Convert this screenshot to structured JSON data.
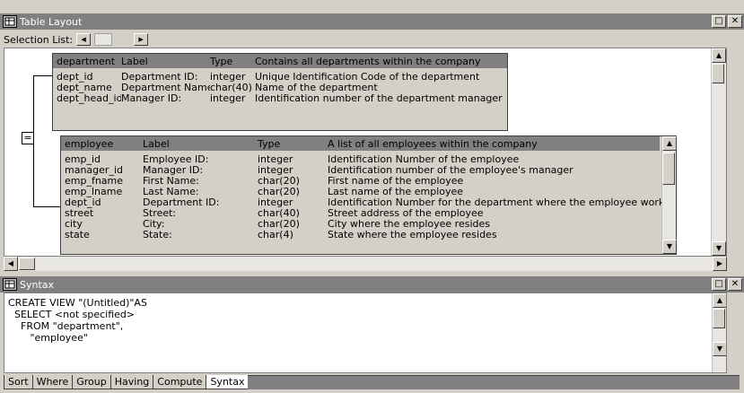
{
  "window": {
    "title": "Table Layout"
  },
  "selection_list": {
    "label": "Selection List:"
  },
  "tables": [
    {
      "name": "department",
      "label_header": "Label",
      "type_header": "Type",
      "comment_header": "Contains all departments within the company",
      "columns": [
        {
          "name": "dept_id",
          "label": "Department ID:",
          "type": "integer",
          "comment": "Unique Identification Code of the department"
        },
        {
          "name": "dept_name",
          "label": "Department Name:",
          "type": "char(40)",
          "comment": "Name of the department"
        },
        {
          "name": "dept_head_id",
          "label": "Manager ID:",
          "type": "integer",
          "comment": "Identification number of the department manager"
        }
      ]
    },
    {
      "name": "employee",
      "label_header": "Label",
      "type_header": "Type",
      "comment_header": "A list of all employees within the company",
      "columns": [
        {
          "name": "emp_id",
          "label": "Employee ID:",
          "type": "integer",
          "comment": "Identification Number of the employee"
        },
        {
          "name": "manager_id",
          "label": "Manager ID:",
          "type": "integer",
          "comment": "Identification number of the employee's manager"
        },
        {
          "name": "emp_fname",
          "label": "First Name:",
          "type": "char(20)",
          "comment": "First name of the employee"
        },
        {
          "name": "emp_lname",
          "label": "Last Name:",
          "type": "char(20)",
          "comment": "Last name of the employee"
        },
        {
          "name": "dept_id",
          "label": "Department ID:",
          "type": "integer",
          "comment": "Identification Number for the department where the employee works"
        },
        {
          "name": "street",
          "label": "Street:",
          "type": "char(40)",
          "comment": "Street address of the employee"
        },
        {
          "name": "city",
          "label": "City:",
          "type": "char(20)",
          "comment": "City where the employee resides"
        },
        {
          "name": "state",
          "label": "State:",
          "type": "char(4)",
          "comment": "State where the employee resides"
        }
      ]
    }
  ],
  "join_operator": "=",
  "syntax": {
    "title": "Syntax",
    "lines": [
      "CREATE VIEW \"(Untitled)\"AS",
      "  SELECT <not specified>",
      "    FROM \"department\",",
      "       \"employee\""
    ]
  },
  "tabs": [
    "Sort",
    "Where",
    "Group",
    "Having",
    "Compute",
    "Syntax"
  ],
  "active_tab": "Syntax"
}
